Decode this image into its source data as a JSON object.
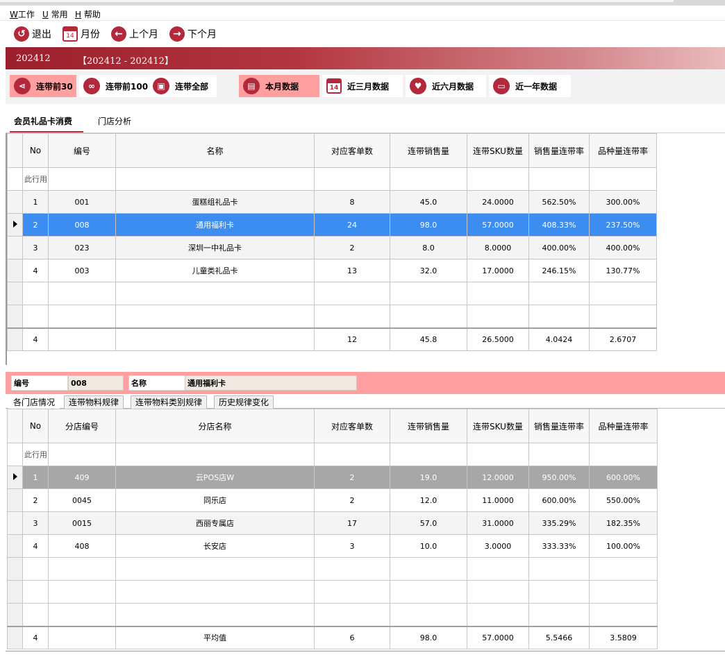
{
  "menu": [
    {
      "key": "W",
      "label": "工作"
    },
    {
      "key": "U",
      "label": " 常用"
    },
    {
      "key": "H",
      "label": " 帮助"
    }
  ],
  "toolbar": {
    "exit": "退出",
    "month": "月份",
    "prev_month": "上个月",
    "next_month": "下个月",
    "calendar_day": "14"
  },
  "period": {
    "current": "202412",
    "range": "【202412 - 202412】"
  },
  "filters": {
    "top30": "连带前30",
    "top100": "连带前100",
    "all": "连带全部",
    "this_month": "本月数据",
    "three_months": "近三月数据",
    "six_months": "近六月数据",
    "one_year": "近一年数据",
    "calendar_day": "14"
  },
  "tabs": {
    "member_gift_card": "会员礼品卡消费",
    "store_analysis": "门店分析"
  },
  "grid1": {
    "headers": [
      "No",
      "编号",
      "名称",
      "对应客单数",
      "连带销售量",
      "连带SKU数量",
      "销售量连带率",
      "品种量连带率"
    ],
    "filter_label": "此行用",
    "rows": [
      [
        "1",
        "001",
        "蛋糕组礼品卡",
        "8",
        "45.0",
        "24.0000",
        "562.50%",
        "300.00%"
      ],
      [
        "2",
        "008",
        "通用福利卡",
        "24",
        "98.0",
        "57.0000",
        "408.33%",
        "237.50%"
      ],
      [
        "3",
        "023",
        "深圳一中礼品卡",
        "2",
        "8.0",
        "8.0000",
        "400.00%",
        "400.00%"
      ],
      [
        "4",
        "003",
        "儿童类礼品卡",
        "13",
        "32.0",
        "17.0000",
        "246.15%",
        "130.77%"
      ]
    ],
    "total": [
      "4",
      "",
      "",
      "12",
      "45.8",
      "26.5000",
      "4.0424",
      "2.6707"
    ]
  },
  "detail": {
    "code_label": "编号",
    "code_value": "008",
    "name_label": "名称",
    "name_value": "通用福利卡"
  },
  "subtabs": {
    "stores": "各门店情况",
    "material_rule": "连带物料规律",
    "category_rule": "连带物料类别规律",
    "history": "历史规律变化"
  },
  "grid2": {
    "headers": [
      "No",
      "分店编号",
      "分店名称",
      "对应客单数",
      "连带销售量",
      "连带SKU数量",
      "销售量连带率",
      "品种量连带率"
    ],
    "filter_label": "此行用",
    "rows": [
      [
        "1",
        "409",
        "云POS店W",
        "2",
        "19.0",
        "12.0000",
        "950.00%",
        "600.00%"
      ],
      [
        "2",
        "0045",
        "同乐店",
        "2",
        "12.0",
        "11.0000",
        "600.00%",
        "550.00%"
      ],
      [
        "3",
        "0015",
        "西丽专属店",
        "17",
        "57.0",
        "31.0000",
        "335.29%",
        "182.35%"
      ],
      [
        "4",
        "408",
        "长安店",
        "3",
        "10.0",
        "3.0000",
        "333.33%",
        "100.00%"
      ]
    ],
    "total": [
      "4",
      "",
      "平均值",
      "6",
      "98.0",
      "57.0000",
      "5.5466",
      "3.5809"
    ]
  },
  "colors": {
    "accent": "#b3283a",
    "highlight": "#ff9f9f",
    "selected_row": "#3b8ef0",
    "selected_row_inactive": "#a7a7a7"
  }
}
